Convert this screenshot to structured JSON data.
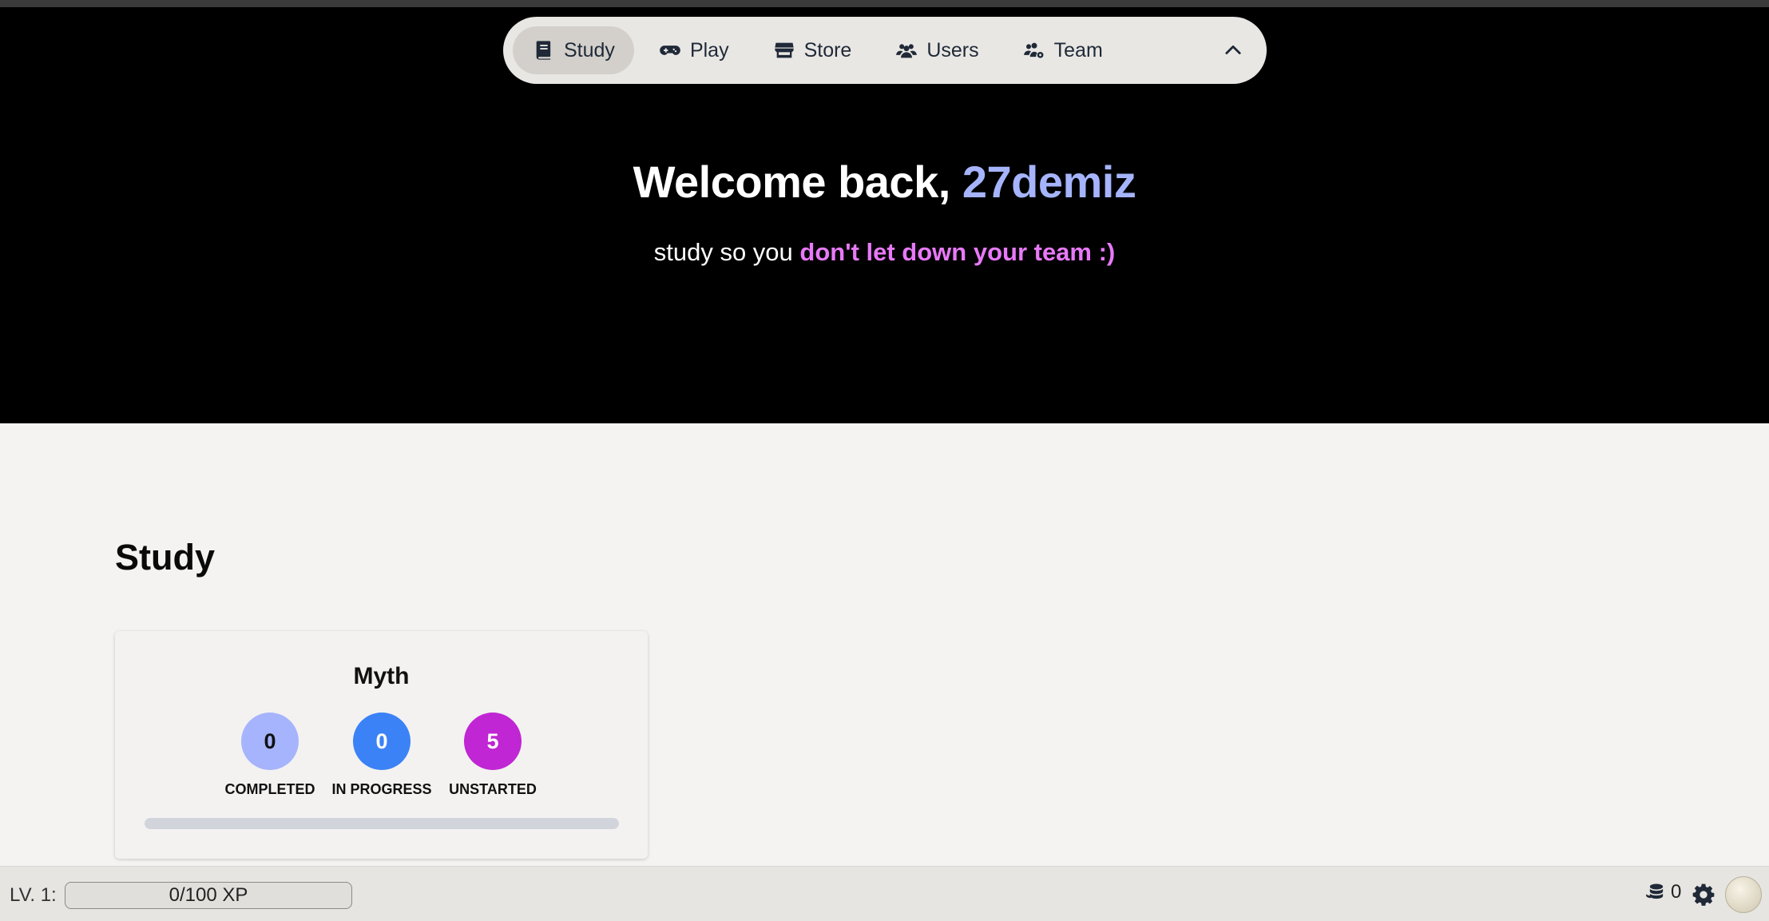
{
  "nav": {
    "items": [
      {
        "label": "Study",
        "icon": "book-icon",
        "active": true
      },
      {
        "label": "Play",
        "icon": "gamepad-icon",
        "active": false
      },
      {
        "label": "Store",
        "icon": "store-icon",
        "active": false
      },
      {
        "label": "Users",
        "icon": "users-icon",
        "active": false
      },
      {
        "label": "Team",
        "icon": "team-settings-icon",
        "active": false
      }
    ],
    "toggle_icon": "chevron-up-icon"
  },
  "hero": {
    "welcome_prefix": "Welcome back, ",
    "username": "27demiz",
    "tagline_prefix": "study so you ",
    "tagline_emphasis": "don't let down your team :)"
  },
  "section": {
    "title": "Study"
  },
  "card": {
    "title": "Myth",
    "stats": [
      {
        "value": "0",
        "label": "COMPLETED",
        "color": "#a5b4fc",
        "text_color": "#111111"
      },
      {
        "value": "0",
        "label": "IN PROGRESS",
        "color": "#3b82f6",
        "text_color": "#ffffff"
      },
      {
        "value": "5",
        "label": "UNSTARTED",
        "color": "#c026d3",
        "text_color": "#ffffff"
      }
    ],
    "progress_fraction": 0
  },
  "footer": {
    "level_label": "LV. 1:",
    "xp_text": "0/100 XP",
    "coins": "0",
    "coins_icon": "coins-icon",
    "settings_icon": "gear-icon",
    "avatar_icon": "avatar"
  },
  "colors": {
    "hero_bg": "#000000",
    "username": "#a5b4fc",
    "emphasis": "#e879f9",
    "page_bg": "#f4f3f1"
  }
}
